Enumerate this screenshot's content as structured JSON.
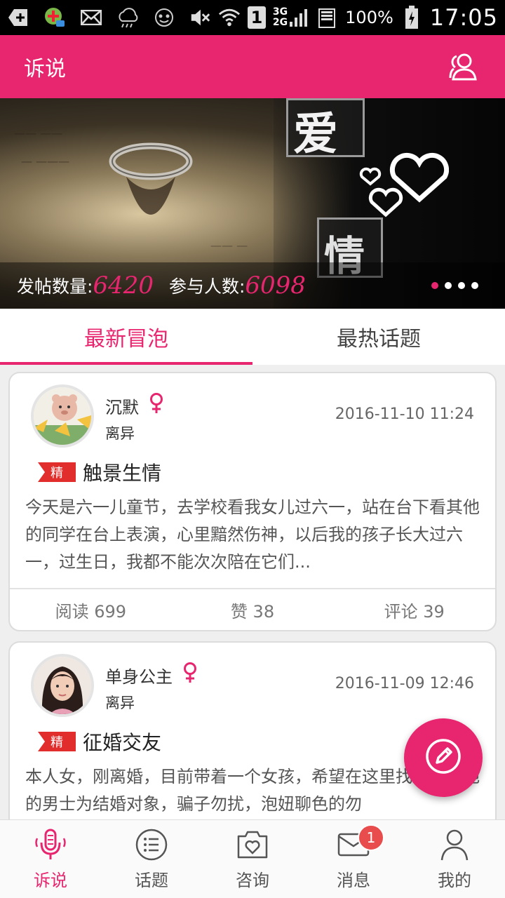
{
  "status_bar": {
    "signal_label_top": "3G",
    "signal_label_bottom": "2G",
    "sim_label": "1",
    "battery": "100%",
    "time": "17:05",
    "left_icons": [
      "add-icon",
      "app-badge-icon",
      "mail-icon",
      "weather-icon",
      "face-icon"
    ],
    "right_icons": [
      "mute-icon",
      "wifi-icon",
      "sim-icon",
      "signal-icon",
      "battery-icon"
    ]
  },
  "appbar": {
    "title": "诉说",
    "action_icon": "users-icon"
  },
  "banner": {
    "post_count_label": "发帖数量:",
    "post_count": "6420",
    "participant_label": "参与人数:",
    "participant_count": "6098",
    "char_love": "爱",
    "char_feeling": "情",
    "page_count": 4,
    "active_page": 1
  },
  "tabs": [
    {
      "label": "最新冒泡",
      "active": true
    },
    {
      "label": "最热话题",
      "active": false
    }
  ],
  "posts": [
    {
      "user": "沉默",
      "gender": "female",
      "status": "离异",
      "time": "2016-11-10 11:24",
      "badge": "精",
      "title": "触景生情",
      "body": "今天是六一儿童节，去学校看我女儿过六一，站在台下看其他的同学在台上表演，心里黯然伤神，以后我的孩子长大过六一，过生日，我都不能次次陪在它们...",
      "reads": "阅读 699",
      "likes": "赞 38",
      "comments": "评论 39"
    },
    {
      "user": "单身公主",
      "gender": "female",
      "status": "离异",
      "time": "2016-11-09 12:46",
      "badge": "精",
      "title": "征婚交友",
      "body": "本人女，刚离婚，目前带着一个女孩，希望在这里找涿州本地的男士为结婚对象，骗子勿扰，泡妞聊色的勿"
    }
  ],
  "fab": {
    "icon": "edit-icon"
  },
  "bottom_nav": [
    {
      "label": "诉说",
      "icon": "microphone-icon",
      "active": true
    },
    {
      "label": "话题",
      "icon": "list-icon",
      "active": false
    },
    {
      "label": "咨询",
      "icon": "consult-icon",
      "active": false
    },
    {
      "label": "消息",
      "icon": "mail-icon",
      "active": false,
      "badge": "1"
    },
    {
      "label": "我的",
      "icon": "person-icon",
      "active": false
    }
  ],
  "colors": {
    "accent": "#e8256f",
    "badge_red": "#e22d2d"
  }
}
